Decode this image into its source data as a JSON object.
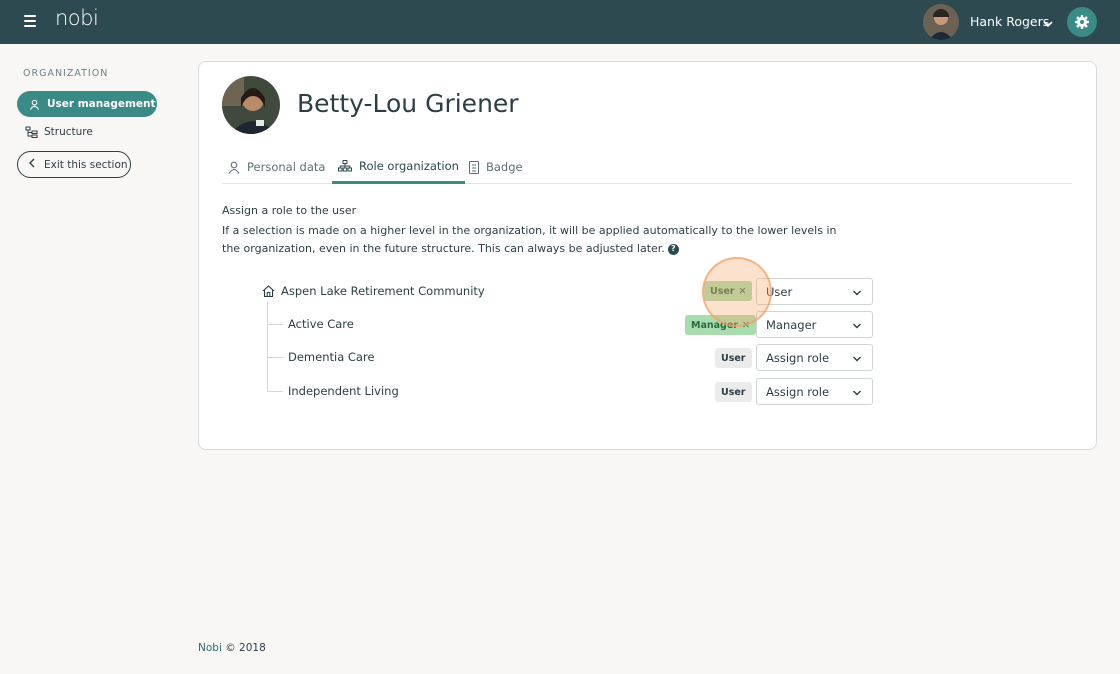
{
  "header": {
    "logo": "nobi",
    "user_name": "Hank Rogers"
  },
  "sidebar": {
    "section_label": "ORGANIZATION",
    "items": [
      {
        "label": "User management",
        "icon": "user-icon",
        "active": true
      },
      {
        "label": "Structure",
        "icon": "structure-icon",
        "active": false
      }
    ],
    "exit_label": "Exit this section"
  },
  "profile": {
    "name": "Betty-Lou Griener"
  },
  "tabs": [
    {
      "label": "Personal data",
      "icon": "person-icon"
    },
    {
      "label": "Role organization",
      "icon": "hierarchy-icon",
      "active": true
    },
    {
      "label": "Badge",
      "icon": "badge-icon"
    }
  ],
  "intro": {
    "title": "Assign a role to the user",
    "text": "If a selection is made on a higher level in the organization, it will be applied automatically to the lower levels in the organization, even in the future structure. This can always be adjusted later."
  },
  "organization": {
    "root": {
      "name": "Aspen Lake Retirement Community",
      "badge": "User",
      "badge_removable": true,
      "role": "User"
    },
    "children": [
      {
        "name": "Active Care",
        "badge": "Manager",
        "badge_removable": true,
        "role": "Manager"
      },
      {
        "name": "Dementia Care",
        "badge": "User",
        "badge_removable": false,
        "role": "Assign role"
      },
      {
        "name": "Independent Living",
        "badge": "User",
        "badge_removable": false,
        "role": "Assign role"
      }
    ]
  },
  "footer": {
    "brand": "Nobi",
    "copyright": "© 2018"
  },
  "colors": {
    "topbar": "#2c4a4f",
    "accent": "#3a8a85",
    "badge_green": "#a8dcae"
  }
}
